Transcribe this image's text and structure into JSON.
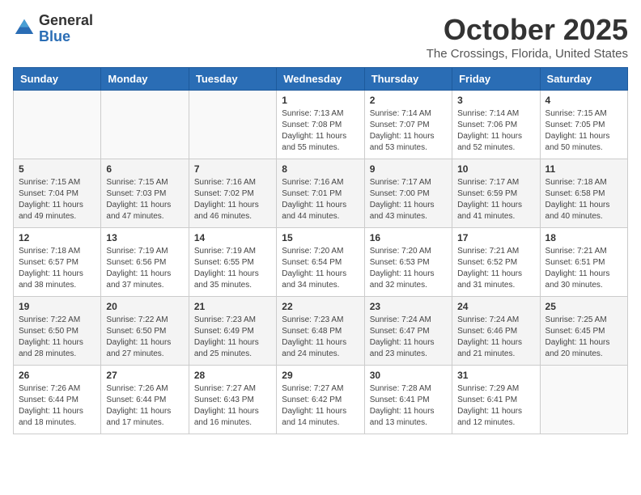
{
  "header": {
    "logo_general": "General",
    "logo_blue": "Blue",
    "month_title": "October 2025",
    "location": "The Crossings, Florida, United States"
  },
  "days_of_week": [
    "Sunday",
    "Monday",
    "Tuesday",
    "Wednesday",
    "Thursday",
    "Friday",
    "Saturday"
  ],
  "weeks": [
    [
      {
        "day": "",
        "info": ""
      },
      {
        "day": "",
        "info": ""
      },
      {
        "day": "",
        "info": ""
      },
      {
        "day": "1",
        "info": "Sunrise: 7:13 AM\nSunset: 7:08 PM\nDaylight: 11 hours and 55 minutes."
      },
      {
        "day": "2",
        "info": "Sunrise: 7:14 AM\nSunset: 7:07 PM\nDaylight: 11 hours and 53 minutes."
      },
      {
        "day": "3",
        "info": "Sunrise: 7:14 AM\nSunset: 7:06 PM\nDaylight: 11 hours and 52 minutes."
      },
      {
        "day": "4",
        "info": "Sunrise: 7:15 AM\nSunset: 7:05 PM\nDaylight: 11 hours and 50 minutes."
      }
    ],
    [
      {
        "day": "5",
        "info": "Sunrise: 7:15 AM\nSunset: 7:04 PM\nDaylight: 11 hours and 49 minutes."
      },
      {
        "day": "6",
        "info": "Sunrise: 7:15 AM\nSunset: 7:03 PM\nDaylight: 11 hours and 47 minutes."
      },
      {
        "day": "7",
        "info": "Sunrise: 7:16 AM\nSunset: 7:02 PM\nDaylight: 11 hours and 46 minutes."
      },
      {
        "day": "8",
        "info": "Sunrise: 7:16 AM\nSunset: 7:01 PM\nDaylight: 11 hours and 44 minutes."
      },
      {
        "day": "9",
        "info": "Sunrise: 7:17 AM\nSunset: 7:00 PM\nDaylight: 11 hours and 43 minutes."
      },
      {
        "day": "10",
        "info": "Sunrise: 7:17 AM\nSunset: 6:59 PM\nDaylight: 11 hours and 41 minutes."
      },
      {
        "day": "11",
        "info": "Sunrise: 7:18 AM\nSunset: 6:58 PM\nDaylight: 11 hours and 40 minutes."
      }
    ],
    [
      {
        "day": "12",
        "info": "Sunrise: 7:18 AM\nSunset: 6:57 PM\nDaylight: 11 hours and 38 minutes."
      },
      {
        "day": "13",
        "info": "Sunrise: 7:19 AM\nSunset: 6:56 PM\nDaylight: 11 hours and 37 minutes."
      },
      {
        "day": "14",
        "info": "Sunrise: 7:19 AM\nSunset: 6:55 PM\nDaylight: 11 hours and 35 minutes."
      },
      {
        "day": "15",
        "info": "Sunrise: 7:20 AM\nSunset: 6:54 PM\nDaylight: 11 hours and 34 minutes."
      },
      {
        "day": "16",
        "info": "Sunrise: 7:20 AM\nSunset: 6:53 PM\nDaylight: 11 hours and 32 minutes."
      },
      {
        "day": "17",
        "info": "Sunrise: 7:21 AM\nSunset: 6:52 PM\nDaylight: 11 hours and 31 minutes."
      },
      {
        "day": "18",
        "info": "Sunrise: 7:21 AM\nSunset: 6:51 PM\nDaylight: 11 hours and 30 minutes."
      }
    ],
    [
      {
        "day": "19",
        "info": "Sunrise: 7:22 AM\nSunset: 6:50 PM\nDaylight: 11 hours and 28 minutes."
      },
      {
        "day": "20",
        "info": "Sunrise: 7:22 AM\nSunset: 6:50 PM\nDaylight: 11 hours and 27 minutes."
      },
      {
        "day": "21",
        "info": "Sunrise: 7:23 AM\nSunset: 6:49 PM\nDaylight: 11 hours and 25 minutes."
      },
      {
        "day": "22",
        "info": "Sunrise: 7:23 AM\nSunset: 6:48 PM\nDaylight: 11 hours and 24 minutes."
      },
      {
        "day": "23",
        "info": "Sunrise: 7:24 AM\nSunset: 6:47 PM\nDaylight: 11 hours and 23 minutes."
      },
      {
        "day": "24",
        "info": "Sunrise: 7:24 AM\nSunset: 6:46 PM\nDaylight: 11 hours and 21 minutes."
      },
      {
        "day": "25",
        "info": "Sunrise: 7:25 AM\nSunset: 6:45 PM\nDaylight: 11 hours and 20 minutes."
      }
    ],
    [
      {
        "day": "26",
        "info": "Sunrise: 7:26 AM\nSunset: 6:44 PM\nDaylight: 11 hours and 18 minutes."
      },
      {
        "day": "27",
        "info": "Sunrise: 7:26 AM\nSunset: 6:44 PM\nDaylight: 11 hours and 17 minutes."
      },
      {
        "day": "28",
        "info": "Sunrise: 7:27 AM\nSunset: 6:43 PM\nDaylight: 11 hours and 16 minutes."
      },
      {
        "day": "29",
        "info": "Sunrise: 7:27 AM\nSunset: 6:42 PM\nDaylight: 11 hours and 14 minutes."
      },
      {
        "day": "30",
        "info": "Sunrise: 7:28 AM\nSunset: 6:41 PM\nDaylight: 11 hours and 13 minutes."
      },
      {
        "day": "31",
        "info": "Sunrise: 7:29 AM\nSunset: 6:41 PM\nDaylight: 11 hours and 12 minutes."
      },
      {
        "day": "",
        "info": ""
      }
    ]
  ]
}
